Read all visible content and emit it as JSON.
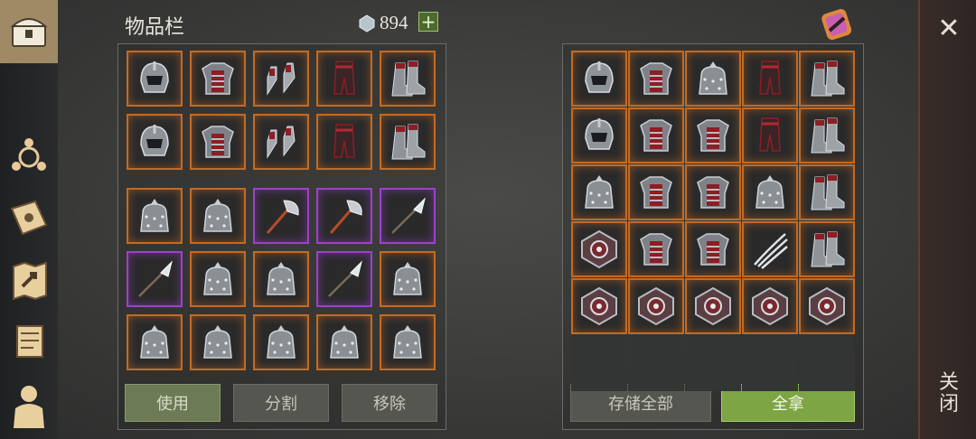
{
  "inventory": {
    "title": "物品栏",
    "currency": "894",
    "plus": "+",
    "buttons": {
      "use": "使用",
      "split": "分割",
      "remove": "移除"
    },
    "top_grid": [
      [
        "helmet",
        "chest-armor",
        "gloves",
        "leg-armor",
        "boots"
      ],
      [
        "helmet",
        "chest-armor",
        "gloves",
        "leg-armor",
        "boots"
      ]
    ],
    "bottom_grid": [
      [
        "spiked-armor",
        "spiked-armor",
        "axe",
        "axe",
        "glaive"
      ],
      [
        "glaive",
        "spiked-armor",
        "spiked-armor",
        "glaive",
        "spiked-armor"
      ],
      [
        "spiked-armor",
        "spiked-armor",
        "spiked-armor",
        "spiked-armor",
        "spiked-armor"
      ]
    ],
    "bottom_rarity": [
      [
        "orange",
        "orange",
        "purple",
        "purple",
        "purple"
      ],
      [
        "purple",
        "orange",
        "orange",
        "purple",
        "orange"
      ],
      [
        "orange",
        "orange",
        "orange",
        "orange",
        "orange"
      ]
    ]
  },
  "loot": {
    "grid": [
      [
        "helmet",
        "chest-armor",
        "spiked-armor",
        "leg-armor",
        "boots"
      ],
      [
        "helmet",
        "chest-armor",
        "chest-armor",
        "leg-armor",
        "boots"
      ],
      [
        "spiked-armor",
        "chest-armor",
        "chest-armor",
        "spiked-armor",
        "boots"
      ],
      [
        "shield",
        "chest-armor",
        "chest-armor",
        "claws",
        "boots"
      ],
      [
        "shield",
        "shield",
        "shield",
        "shield",
        "shield"
      ],
      [
        "",
        "",
        "",
        "",
        ""
      ]
    ],
    "buttons": {
      "store_all": "存储全部",
      "take_all": "全拿"
    }
  },
  "close": {
    "x": "✕",
    "label": "关闭"
  },
  "sidebar": [
    "chest-icon",
    "faction-icon",
    "sun-book-icon",
    "map-icon",
    "scroll-icon",
    "character-icon"
  ],
  "colors": {
    "orange_frame": "#c46a22",
    "purple_frame": "#9b42c8",
    "take_all_green": "#7da544"
  }
}
